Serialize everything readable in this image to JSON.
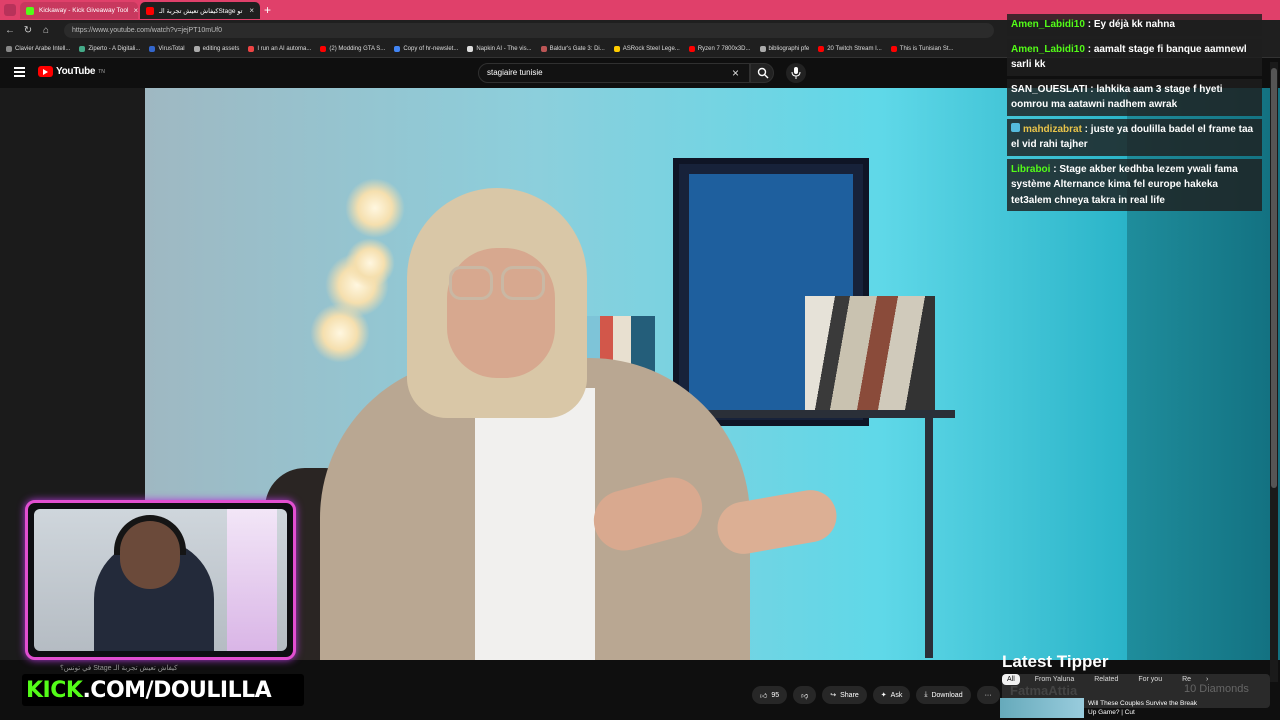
{
  "browser": {
    "tabs": [
      {
        "label": "Kickaway - Kick Giveaway Tool",
        "active": false,
        "color": "#53fc18"
      },
      {
        "label": "كيفاش تعيش تجربة الـStage في تو...",
        "active": true,
        "color": "#ff0000"
      }
    ],
    "new_tab": "+",
    "url": "https://www.youtube.com/watch?v=jejPT10mUf0",
    "bookmarks": [
      "Clavier Arabe Intell...",
      "Ziperto - A Digitali...",
      "VirusTotal",
      "editing assets",
      "I run an AI automa...",
      "(2) Modding GTA S...",
      "Copy of hr-newslet...",
      "Napkin AI - The vis...",
      "Baldur's Gate 3: Di...",
      "ASRock Steel Lege...",
      "Ryzen 7 7800x3D...",
      "bibliographi pfe",
      "20 Twitch Stream I...",
      "This is Tunisian St..."
    ]
  },
  "youtube": {
    "logo_text": "YouTube",
    "logo_sup": "TN",
    "search_value": "stagiaire tunisie",
    "actions": [
      {
        "icon": "like-icon",
        "label": "95"
      },
      {
        "icon": "dislike-icon",
        "label": ""
      },
      {
        "icon": "share-icon",
        "label": "Share"
      },
      {
        "icon": "ask-icon",
        "label": "Ask"
      },
      {
        "icon": "download-icon",
        "label": "Download"
      },
      {
        "icon": "more-icon",
        "label": "···"
      }
    ],
    "chips": [
      "All",
      "From Yaluna",
      "Related",
      "For you",
      "Re"
    ],
    "suggestion_title": "Will These Couples Survive the Break Up Game? | Cut",
    "video_title_partial": "في تونس؟ Stage كيفاش تعيش تجربة الـ"
  },
  "chat": [
    {
      "user": "Amen_Labidi10",
      "user_color": "#53fc18",
      "text": "Ey déjà kk nahna"
    },
    {
      "user": "Amen_Labidi10",
      "user_color": "#53fc18",
      "text": "aamalt stage fi banque aamnewl sarli kk"
    },
    {
      "user": "SAN_OUESLATI",
      "user_color": "#ffffff",
      "text": "lahkika aam 3 stage f hyeti oomrou ma aatawni nadhem awrak"
    },
    {
      "user": "mahdizabrat",
      "user_color": "#e8c34a",
      "text": "juste ya doulilla badel el frame taa el vid rahi tajher"
    },
    {
      "user": "Libraboi",
      "user_color": "#53fc18",
      "text": "Stage akber kedhba lezem ywali fama système Alternance kima fel europe hakeka tet3alem chneya takra in real life"
    }
  ],
  "overlay": {
    "kick_prefix": "KICK",
    "kick_suffix": ".COM/DOULILLA",
    "latest_tipper_label": "Latest Tipper",
    "tipper_name": "FatmaAttia",
    "tipper_amount": "10 Diamonds"
  }
}
